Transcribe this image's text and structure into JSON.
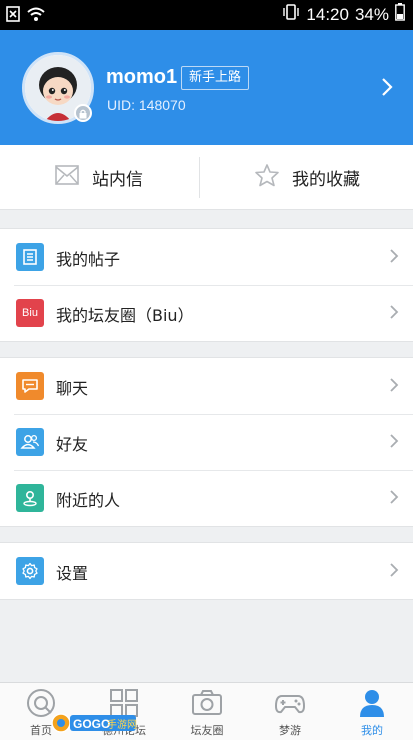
{
  "status_bar": {
    "time": "14:20",
    "battery": "34%"
  },
  "profile": {
    "username": "momo1",
    "level": "新手上路",
    "uid": "UID: 148070"
  },
  "quick_actions": [
    {
      "label": "站内信",
      "icon": "envelope-icon"
    },
    {
      "label": "我的收藏",
      "icon": "star-icon"
    }
  ],
  "menu": {
    "group1": [
      {
        "label": "我的帖子",
        "icon": "posts-icon",
        "color": "#3da3e6"
      },
      {
        "label": "我的坛友圈（Biu）",
        "icon": "biu-icon",
        "icon_text": "Biu",
        "color": "#e2434c"
      }
    ],
    "group2": [
      {
        "label": "聊天",
        "icon": "chat-icon",
        "color": "#f08a2c"
      },
      {
        "label": "好友",
        "icon": "friends-icon",
        "color": "#3da3e6"
      },
      {
        "label": "附近的人",
        "icon": "nearby-icon",
        "color": "#2fb59a"
      }
    ],
    "group3": [
      {
        "label": "设置",
        "icon": "settings-icon",
        "color": "#3da3e6"
      }
    ]
  },
  "tabs": [
    {
      "label": "首页",
      "icon": "home-icon"
    },
    {
      "label": "德州论坛",
      "icon": "forum-icon"
    },
    {
      "label": "坛友圈",
      "icon": "camera-icon"
    },
    {
      "label": "梦游",
      "icon": "gamepad-icon"
    },
    {
      "label": "我的",
      "icon": "user-icon",
      "active": true
    }
  ],
  "watermark": {
    "text": "GOGO手游网"
  },
  "colors": {
    "accent": "#2e8ee8",
    "background": "#eef0f2"
  }
}
